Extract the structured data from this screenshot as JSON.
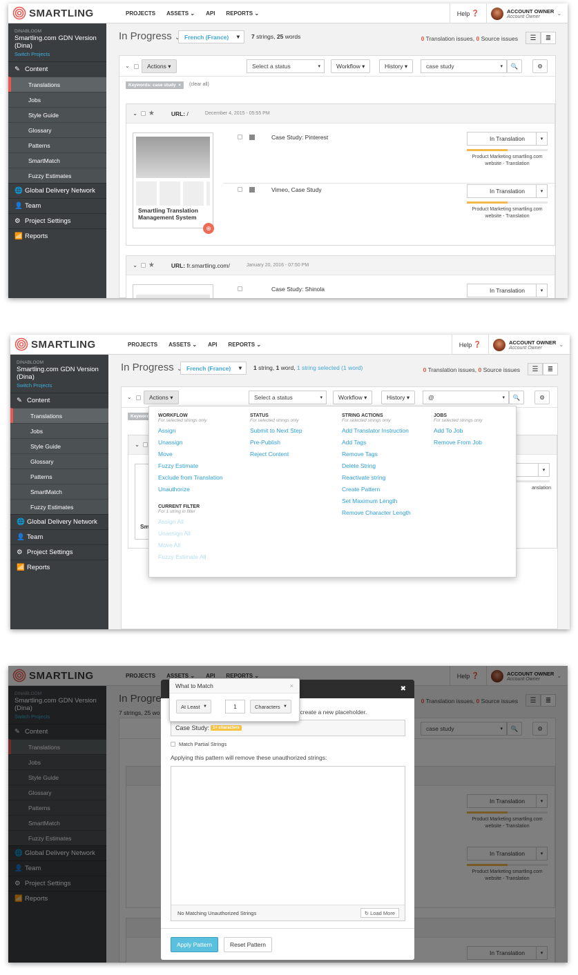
{
  "brand": {
    "logo_text": "SMARTLING",
    "accent": "#e75a52",
    "link": "#3fa6d8"
  },
  "topnav": {
    "items": [
      {
        "label": "PROJECTS"
      },
      {
        "label": "ASSETS"
      },
      {
        "label": "API"
      },
      {
        "label": "REPORTS"
      }
    ],
    "help": "Help"
  },
  "account": {
    "name": "ACCOUNT OWNER",
    "role": "Account Owner"
  },
  "sidebar": {
    "org": "DINABLOOM",
    "project": "Smartling.com GDN Version (Dina)",
    "switch": "Switch Projects",
    "content": "Content",
    "items": [
      {
        "label": "Translations"
      },
      {
        "label": "Jobs"
      },
      {
        "label": "Style Guide"
      },
      {
        "label": "Glossary"
      },
      {
        "label": "Patterns"
      },
      {
        "label": "SmartMatch"
      },
      {
        "label": "Fuzzy Estimates"
      }
    ],
    "sections": [
      {
        "label": "Global Delivery Network"
      },
      {
        "label": "Team"
      },
      {
        "label": "Project Settings"
      },
      {
        "label": "Reports"
      }
    ]
  },
  "header": {
    "status": "In Progress",
    "language": "French (France)",
    "s1_count": {
      "strings": "7",
      "strings_word": "strings",
      "words": "25",
      "words_word": "words"
    },
    "s2_count": {
      "strings": "1",
      "strings_word": "string",
      "words": "1",
      "words_word": "word",
      "selected": "1 string selected (1 word)"
    },
    "s3_count": "7 strings, 25 wo",
    "issues": {
      "translation_count": "0",
      "translation_label": "Translation issues,",
      "source_count": "0",
      "source_label": "Source issues"
    }
  },
  "toolbar": {
    "actions": "Actions",
    "status_placeholder": "Select a status",
    "workflow": "Workflow",
    "history": "History",
    "search_value_1": "case study",
    "search_value_2": "@",
    "search_value_3": "case study"
  },
  "filter": {
    "pill": "Keywords: case study",
    "clear": "(clear all)"
  },
  "groups": [
    {
      "url_label": "URL:",
      "url": "/",
      "date": "December 4, 2015 - 05:55 PM",
      "thumb_caption": "Smartling Translation Management System",
      "strings": [
        {
          "text_pre": "Case Study:",
          "text_post": " Pinterest",
          "status": "In Translation",
          "progress": 0.5,
          "job": "Product Marketing smartling.com website - Translation"
        },
        {
          "text_pre": "Vimeo,",
          "text_post": " Case Study",
          "status": "In Translation",
          "progress": 0.5,
          "job": "Product Marketing smartling.com website - Translation"
        }
      ]
    },
    {
      "url_label": "URL:",
      "url": "fr.smartling.com/",
      "date": "January 20, 2016 - 07:50 PM",
      "strings": [
        {
          "text_pre": "Case Study:",
          "text_post": " Shinola",
          "status": "In Translation",
          "progress": 0.5
        }
      ]
    }
  ],
  "s2_partial": {
    "thumb_caption": "Sm Co",
    "job_tail": "anslation",
    "pill_tail": "Keyword"
  },
  "actions_menu": {
    "workflow": {
      "title": "WORKFLOW",
      "sub": "For selected strings only",
      "items": [
        "Assign",
        "Unassign",
        "Move",
        "Fuzzy Estimate",
        "Exclude from Translation",
        "Unauthorize"
      ]
    },
    "status": {
      "title": "STATUS",
      "sub": "For selected strings only",
      "items": [
        "Submit to Next Step",
        "Pre-Publish",
        "Reject Content"
      ]
    },
    "string_actions": {
      "title": "STRING ACTIONS",
      "sub": "For selected strings only",
      "items": [
        "Add Translator Instruction",
        "Add Tags",
        "Remove Tags",
        "Delete String",
        "Reactivate string",
        "Create Pattern",
        "Set Maximum Length",
        "Remove Character Length"
      ]
    },
    "jobs": {
      "title": "JOBS",
      "sub": "For selected strings only",
      "items": [
        "Add To Job",
        "Remove From Job"
      ]
    },
    "current_filter": {
      "title": "CURRENT FILTER",
      "sub": "For 1 string in filter",
      "items": [
        "Assign All",
        "Unassign All",
        "Move All",
        "Fuzzy Estimate All"
      ]
    }
  },
  "pattern_modal": {
    "instruction": "text to create a new placeholder.",
    "input_text": "Case Study:",
    "chip": "1+ characters",
    "partial": "Match Partial Strings",
    "applying": "Applying this pattern will remove these unauthorized strings:",
    "no_match": "No Matching Unauthorized Strings",
    "load_more": "Load More",
    "apply": "Apply Pattern",
    "reset": "Reset Pattern",
    "popover_title": "What to Match",
    "at_least": "At Least",
    "number": "1",
    "unit": "Characters",
    "title_peek": "In Progres"
  }
}
